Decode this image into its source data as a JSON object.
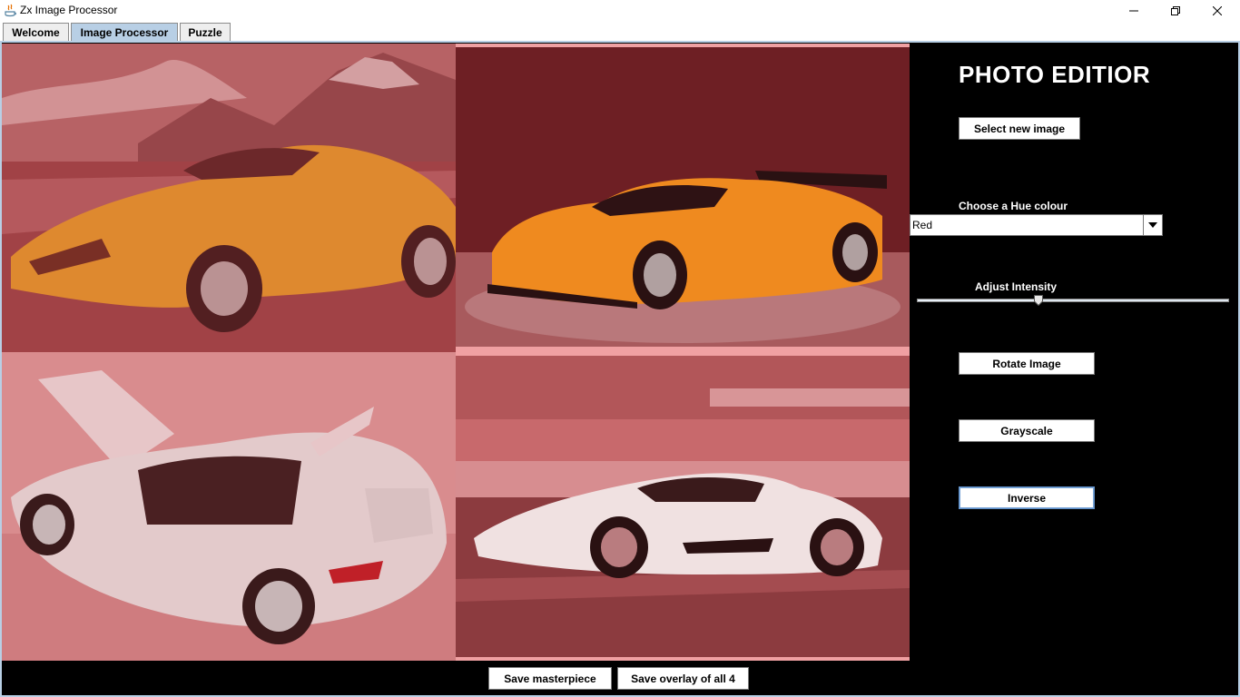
{
  "window": {
    "title": "Zx Image Processor",
    "controls": [
      "minimize-icon",
      "restore-icon",
      "close-icon"
    ]
  },
  "tabs": [
    {
      "label": "Welcome",
      "active": false
    },
    {
      "label": "Image Processor",
      "active": true
    },
    {
      "label": "Puzzle",
      "active": false
    }
  ],
  "images": [
    {
      "subject": "orange convertible supercar in desert"
    },
    {
      "subject": "orange race supercar with rear wing"
    },
    {
      "subject": "silver convertible sports car with doors open"
    },
    {
      "subject": "white supercar driving"
    }
  ],
  "editor": {
    "title": "PHOTO EDITIOR",
    "select_image_label": "Select new image",
    "hue_label": "Choose a Hue colour",
    "hue_selected": "Red",
    "intensity_label": "Adjust Intensity",
    "intensity_value": 0.39,
    "rotate_label": "Rotate Image",
    "grayscale_label": "Grayscale",
    "inverse_label": "Inverse"
  },
  "bottom": {
    "save_label": "Save masterpiece",
    "save_overlay_label": "Save overlay of all 4"
  },
  "colors": {
    "tint": "#c0393b",
    "tab_active": "#b8cfe5",
    "panel_bg": "#000000"
  }
}
